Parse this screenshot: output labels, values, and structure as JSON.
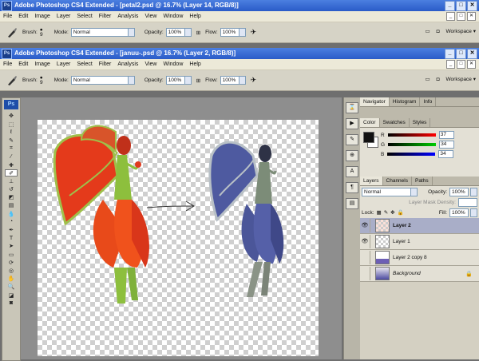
{
  "windows": [
    {
      "title": "Adobe Photoshop CS4 Extended - [petal2.psd @ 16.7% (Layer 14, RGB/8)]"
    },
    {
      "title": "Adobe Photoshop CS4 Extended - [januu-.psd @ 16.7% (Layer 2, RGB/8)]"
    }
  ],
  "app_icon": "Ps",
  "menu": [
    "File",
    "Edit",
    "Image",
    "Layer",
    "Select",
    "Filter",
    "Analysis",
    "View",
    "Window",
    "Help"
  ],
  "options": {
    "brush_label": "Brush:",
    "brush_size": "9",
    "mode_label": "Mode:",
    "mode_value": "Normal",
    "opacity_label": "Opacity:",
    "opacity_value": "100%",
    "flow_label": "Flow:",
    "flow_value": "100%",
    "workspace": "Workspace ▾"
  },
  "panels": {
    "navigator_tabs": [
      "Navigator",
      "Histogram",
      "Info"
    ],
    "color_tabs": [
      "Color",
      "Swatches",
      "Styles"
    ],
    "color": {
      "r_label": "R",
      "r_value": "37",
      "g_label": "G",
      "g_value": "34",
      "b_label": "B",
      "b_value": "34"
    },
    "layers_tabs": [
      "Layers",
      "Channels",
      "Paths"
    ],
    "layers": {
      "blend_mode": "Normal",
      "opacity_label": "Opacity:",
      "opacity_value": "100%",
      "layer_mask_density": "Layer Mask Density:",
      "lock_label": "Lock:",
      "fill_label": "Fill:",
      "fill_value": "100%",
      "items": [
        {
          "name": "Layer 2"
        },
        {
          "name": "Layer 1"
        },
        {
          "name": "Layer 2 copy 8"
        },
        {
          "name": "Background"
        }
      ]
    }
  },
  "colors": {
    "titlebar": "#2a5bc8",
    "selected_layer": "#a9aec8",
    "fairy_red": "#e4331b",
    "fairy_blue": "#4e5aa0"
  }
}
